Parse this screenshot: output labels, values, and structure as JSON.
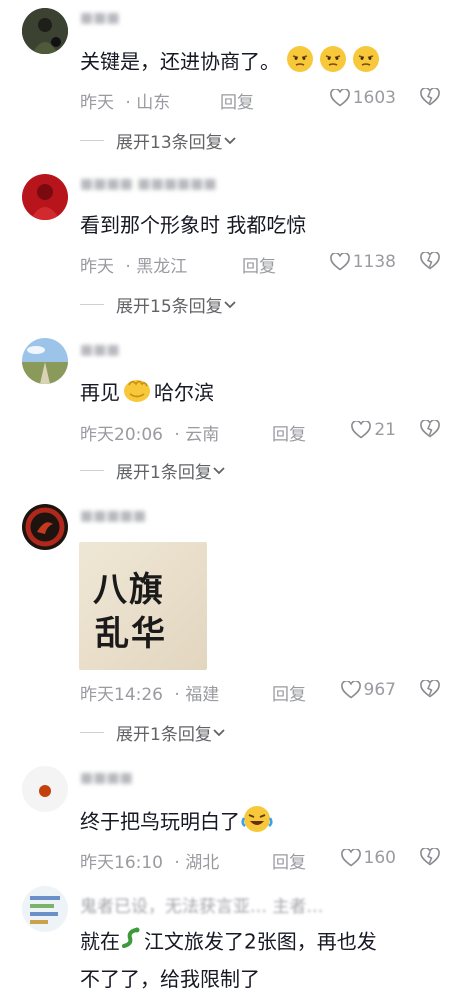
{
  "comments": [
    {
      "text": "关键是，还进协商了。",
      "time": "昨天",
      "location": "山东",
      "reply_label": "回复",
      "likes": "1603",
      "expand": "展开13条回复"
    },
    {
      "text": "看到那个形象时  我都吃惊",
      "time": "昨天",
      "location": "黑龙江",
      "reply_label": "回复",
      "likes": "1138",
      "expand": "展开15条回复"
    },
    {
      "text_before": "再见",
      "text_after": "哈尔滨",
      "time": "昨天20:06",
      "location": "云南",
      "reply_label": "回复",
      "likes": "21",
      "expand": "展开1条回复"
    },
    {
      "image_line1": "八旗",
      "image_line2": "乱华",
      "time": "昨天14:26",
      "location": "福建",
      "reply_label": "回复",
      "likes": "967",
      "expand": "展开1条回复"
    },
    {
      "text": "终于把鸟玩明白了",
      "time": "昨天16:10",
      "location": "湖北",
      "reply_label": "回复",
      "likes": "160"
    },
    {
      "reply_to": "鬼者已设，无法获言亚…        主者…",
      "line1_before": "就在",
      "line1_after": "江文旅发了2张图，再也发",
      "line2": "不了了，给我限制了"
    }
  ],
  "icons": [
    "heart-icon",
    "dislike-heart-icon",
    "chevron-down-icon"
  ],
  "colors": {
    "text": "#161823",
    "meta": "#9a9ba0",
    "expand": "#616266",
    "background": "#ffffff"
  }
}
